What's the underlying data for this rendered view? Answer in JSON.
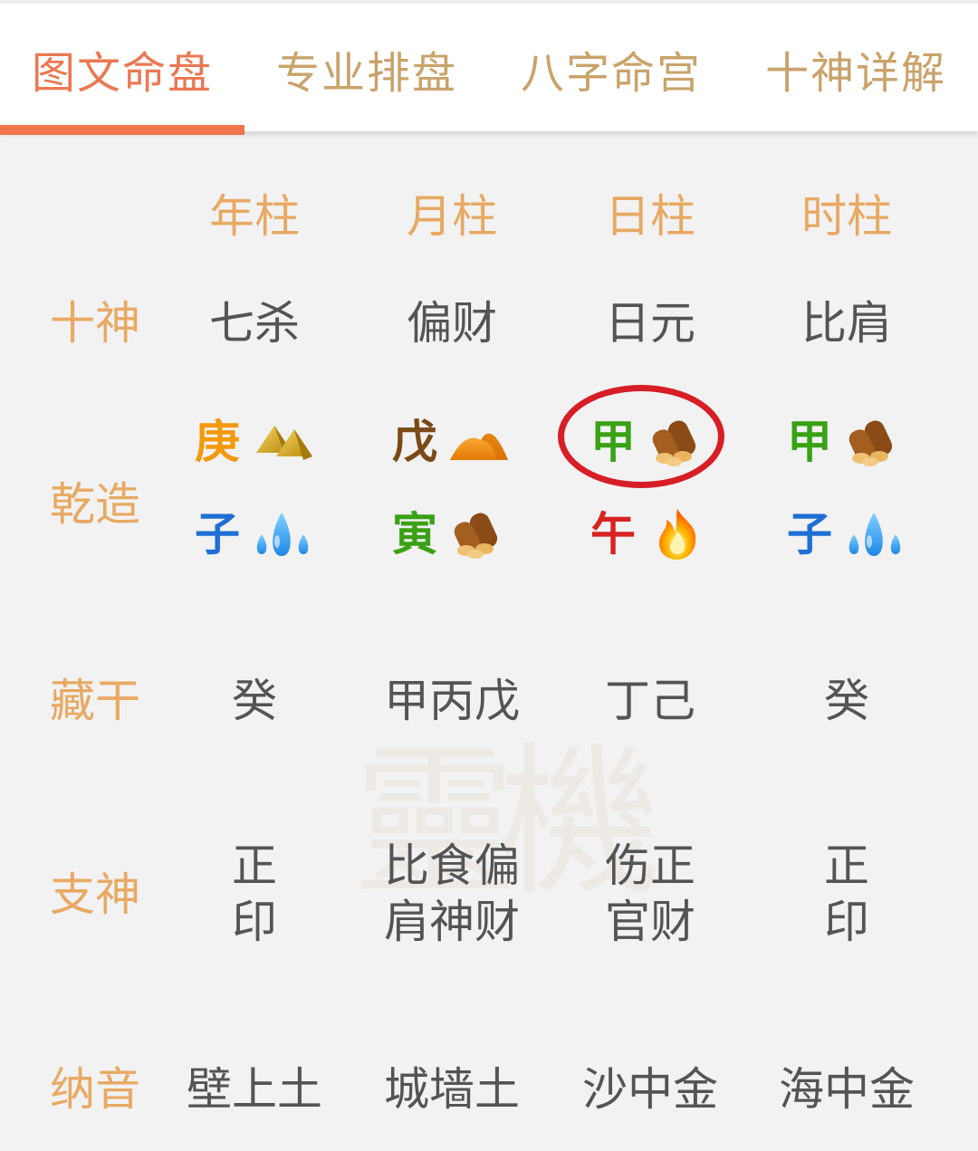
{
  "tabs": [
    {
      "label": "图文命盘",
      "active": true
    },
    {
      "label": "专业排盘",
      "active": false
    },
    {
      "label": "八字命宫",
      "active": false
    },
    {
      "label": "十神详解",
      "active": false
    }
  ],
  "columns": [
    "年柱",
    "月柱",
    "日柱",
    "时柱"
  ],
  "row_labels": {
    "shishen": "十神",
    "qianzao": "乾造",
    "canggan": "藏干",
    "zhishen": "支神",
    "nayin": "纳音"
  },
  "shishen": [
    "七杀",
    "偏财",
    "日元",
    "比肩"
  ],
  "stems": [
    {
      "char": "庚",
      "color": "#f39a0c",
      "icon": "metal-icon"
    },
    {
      "char": "戊",
      "color": "#7a4a17",
      "icon": "earth-icon"
    },
    {
      "char": "甲",
      "color": "#3aa115",
      "icon": "wood-icon"
    },
    {
      "char": "甲",
      "color": "#3aa115",
      "icon": "wood-icon"
    }
  ],
  "branches": [
    {
      "char": "子",
      "color": "#1f6fd4",
      "icon": "water-icon"
    },
    {
      "char": "寅",
      "color": "#3aa115",
      "icon": "wood-icon"
    },
    {
      "char": "午",
      "color": "#d92222",
      "icon": "fire-icon"
    },
    {
      "char": "子",
      "color": "#1f6fd4",
      "icon": "water-icon"
    }
  ],
  "canggan": [
    "癸",
    "甲丙戊",
    "丁己",
    "癸"
  ],
  "zhishen": [
    {
      "line1": "正",
      "line2": "印"
    },
    {
      "line1": "比食偏",
      "line2": "肩神财"
    },
    {
      "line1": "伤正",
      "line2": "官财"
    },
    {
      "line1": "正",
      "line2": "印"
    }
  ],
  "nayin": [
    "壁上土",
    "城墙土",
    "沙中金",
    "海中金"
  ],
  "highlight": {
    "pillar": "日柱",
    "color": "#d71e26"
  },
  "colors": {
    "accent": "#f07548",
    "label": "#e8a963",
    "tab_inactive": "#c9a36b",
    "text": "#545454"
  }
}
